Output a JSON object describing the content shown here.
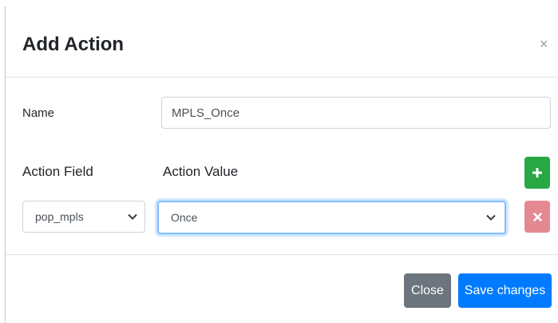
{
  "dialog": {
    "title": "Add Action",
    "close_glyph": "×"
  },
  "form": {
    "name_label": "Name",
    "name_value": "MPLS_Once",
    "action_field_label": "Action Field",
    "action_value_label": "Action Value",
    "action_field_selected": "pop_mpls",
    "action_value_selected": "Once",
    "add_glyph": "+",
    "remove_glyph": "✖"
  },
  "footer": {
    "close_label": "Close",
    "save_label": "Save changes"
  },
  "icons": {
    "add": "plus-icon",
    "remove": "times-icon",
    "dropdown": "chevron-down-icon",
    "dismiss": "close-icon"
  },
  "colors": {
    "add_button": "#28a745",
    "remove_button": "#e48892",
    "close_button": "#6c757d",
    "save_button": "#007bff",
    "focus_border": "#80bdff"
  }
}
